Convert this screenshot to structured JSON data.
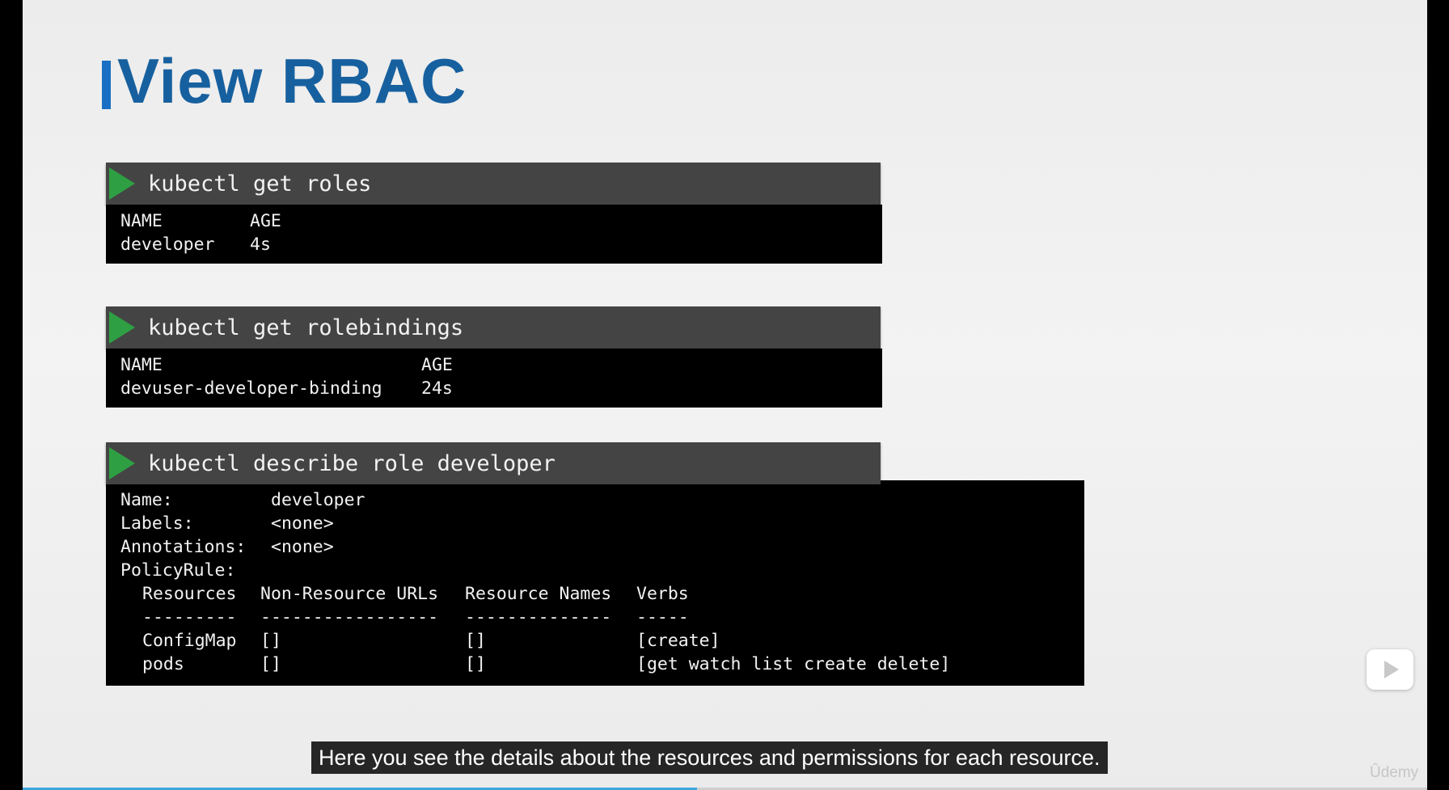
{
  "slide": {
    "title": "View RBAC",
    "accent_color": "#1a6fc4"
  },
  "cmd1": {
    "command": "kubectl get roles",
    "rows": [
      [
        "NAME",
        "AGE"
      ],
      [
        "developer",
        "4s"
      ]
    ]
  },
  "cmd2": {
    "command": "kubectl get rolebindings",
    "rows": [
      [
        "NAME",
        "AGE"
      ],
      [
        "devuser-developer-binding",
        "24s"
      ]
    ]
  },
  "cmd3": {
    "command": "kubectl describe role developer",
    "fields": [
      [
        "Name:",
        "developer"
      ],
      [
        "Labels:",
        "<none>"
      ],
      [
        "Annotations:",
        "<none>"
      ],
      [
        "PolicyRule:",
        ""
      ]
    ],
    "table_header": [
      "Resources",
      "Non-Resource URLs",
      "Resource Names",
      "Verbs"
    ],
    "table_sep": [
      "---------",
      "-----------------",
      "--------------",
      "-----"
    ],
    "table_rows": [
      [
        "ConfigMap",
        "[]",
        "[]",
        "[create]"
      ],
      [
        "pods",
        "[]",
        "[]",
        "[get watch list create delete]"
      ]
    ]
  },
  "caption": "Here you see the details about the resources and permissions for each resource.",
  "player": {
    "progress": 0.48,
    "side_button_icon": "play-icon",
    "watermark": "Ûdemy"
  }
}
